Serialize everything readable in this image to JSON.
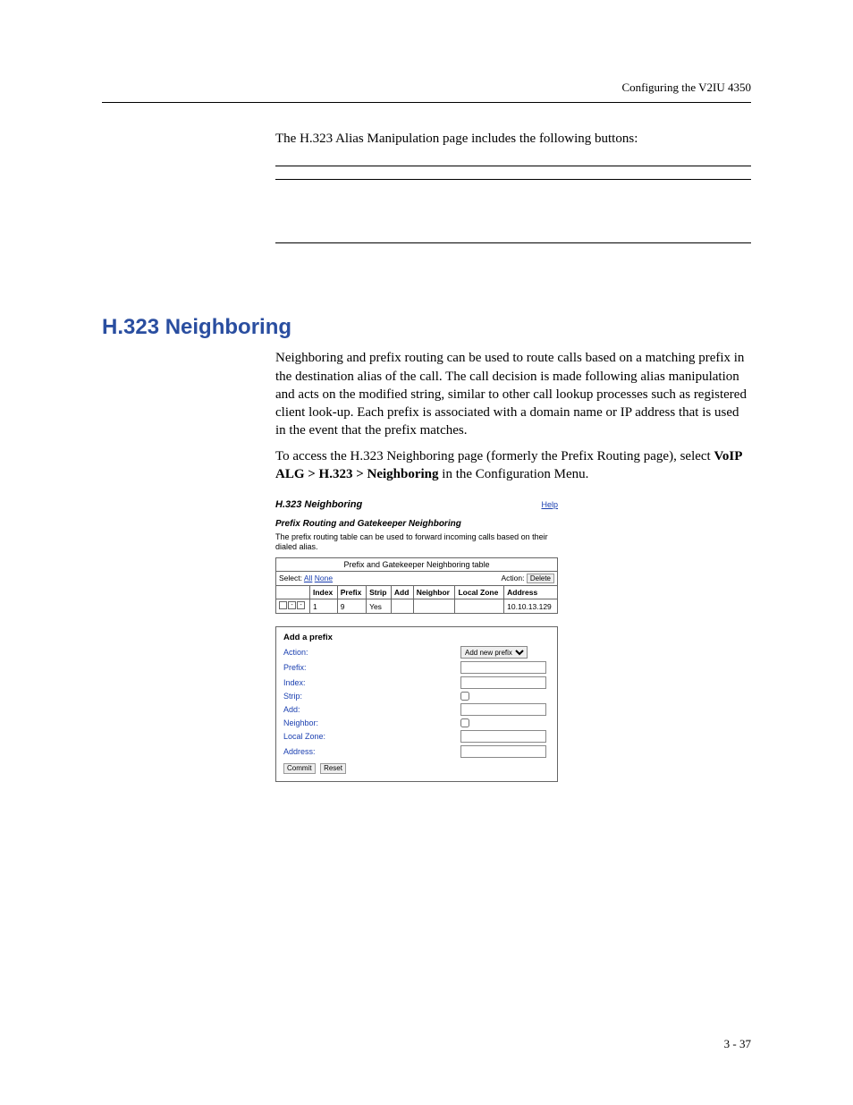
{
  "header": {
    "running_title": "Configuring the V2IU 4350"
  },
  "intro": {
    "sentence": "The H.323 Alias Manipulation page includes the following buttons:"
  },
  "section": {
    "title": "H.323 Neighboring",
    "para1": "Neighboring and prefix routing can be used to route calls based on a matching prefix in the destination alias of the call. The call decision is made following alias manipulation and acts on the modified string, similar to other call lookup processes such as registered client look-up. Each prefix is associated with a domain name or IP address that is used in the event that the prefix matches.",
    "para2_a": "To access the H.323 Neighboring page (formerly the Prefix Routing page), select ",
    "para2_b": "VoIP ALG > H.323 > Neighboring",
    "para2_c": " in the Configuration Menu."
  },
  "shot": {
    "title": "H.323 Neighboring",
    "help": "Help",
    "subheading": "Prefix Routing and Gatekeeper Neighboring",
    "desc": "The prefix routing table can be used to forward incoming calls based on their dialed alias.",
    "table": {
      "caption": "Prefix and Gatekeeper Neighboring table",
      "select_label": "Select:",
      "select_all": "All",
      "select_none": "None",
      "action_label": "Action:",
      "delete_btn": "Delete",
      "headers": [
        "",
        "Index",
        "Prefix",
        "Strip",
        "Add",
        "Neighbor",
        "Local Zone",
        "Address"
      ],
      "rows": [
        {
          "index": "1",
          "prefix": "9",
          "strip": "Yes",
          "add": "",
          "neighbor": "",
          "local_zone": "",
          "address": "10.10.13.129"
        }
      ]
    },
    "form": {
      "title": "Add a prefix",
      "fields": {
        "action_label": "Action:",
        "action_option": "Add new prefix",
        "prefix_label": "Prefix:",
        "index_label": "Index:",
        "strip_label": "Strip:",
        "add_label": "Add:",
        "neighbor_label": "Neighbor:",
        "localzone_label": "Local Zone:",
        "address_label": "Address:"
      },
      "buttons": {
        "commit": "Commit",
        "reset": "Reset"
      }
    }
  },
  "footer": {
    "page": "3 - 37"
  }
}
